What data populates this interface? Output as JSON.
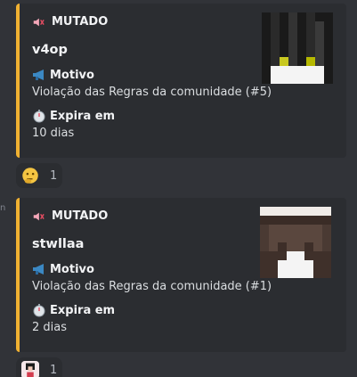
{
  "messages": [
    {
      "author_label": "MUTADO",
      "username": "v4op",
      "field1_name": "Motivo",
      "field1_value": "Violação das Regras da comunidade (#5)",
      "field2_name": "Expira em",
      "field2_value": "10 dias",
      "accent_color": "#f0b132",
      "reaction": {
        "emoji": "thinking-face",
        "count": "1"
      }
    },
    {
      "author_label": "MUTADO",
      "username": "stwllaa",
      "field1_name": "Motivo",
      "field1_value": "Violação das Regras da comunidade (#1)",
      "field2_name": "Expira em",
      "field2_value": "2 dias",
      "accent_color": "#f0b132",
      "reaction": {
        "emoji": "custom-avatar-emoji",
        "count": "1"
      }
    }
  ],
  "side_mark": "n"
}
